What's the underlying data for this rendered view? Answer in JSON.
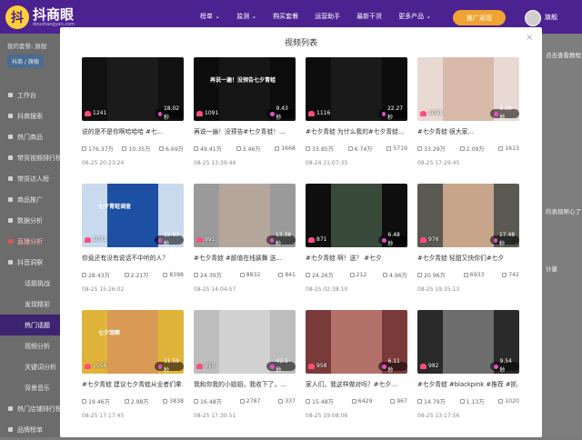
{
  "app": {
    "logo_text": "抖商眼",
    "logo_sub": "doushangyan.com",
    "logo_mark": "抖"
  },
  "nav": [
    "榜单 ⌄",
    "监测 ⌄",
    "购买套餐",
    "运营助手",
    "最新干货",
    "更多产品 ⌄"
  ],
  "header": {
    "promo_label": "推广返现",
    "user_name": "旗舰"
  },
  "sidebar": {
    "plan": "我的套餐: 旗舰",
    "pill": "抖商 / 旗舰",
    "items": [
      {
        "label": "工作台",
        "level": "top"
      },
      {
        "label": "抖商搜索",
        "level": "top"
      },
      {
        "label": "热门商品",
        "level": "top"
      },
      {
        "label": "带货视频排行榜",
        "level": "top"
      },
      {
        "label": "带货达人榜",
        "level": "top"
      },
      {
        "label": "商品推广",
        "level": "top"
      },
      {
        "label": "数据分析",
        "level": "top"
      },
      {
        "label": "直播分析",
        "level": "top",
        "state": "red"
      },
      {
        "label": "抖音洞察",
        "level": "top"
      },
      {
        "label": "话题挑战",
        "level": "sub"
      },
      {
        "label": "发现精彩",
        "level": "sub"
      },
      {
        "label": "热门话题",
        "level": "sub",
        "state": "active"
      },
      {
        "label": "视频分析",
        "level": "sub"
      },
      {
        "label": "关键词分析",
        "level": "sub"
      },
      {
        "label": "背景音乐",
        "level": "sub"
      },
      {
        "label": "热门店铺排行榜",
        "level": "top"
      },
      {
        "label": "品牌榜单",
        "level": "top"
      }
    ]
  },
  "background": {
    "right_top": "点击查看教程",
    "right_mid": "的表现帮心了",
    "right_lower": "计量"
  },
  "modal": {
    "title": "视频列表",
    "close": "×"
  },
  "videos": [
    {
      "likes": "1241",
      "duration": "18.02秒",
      "title": "说的是不是你啊哈哈哈 #七...",
      "plays": "176.37万",
      "comments": "10.35万",
      "shares": "6.69万",
      "date": "08-25 20:23:24",
      "bg": "#111111",
      "inner": "#1b1b1b"
    },
    {
      "likes": "1091",
      "duration": "9.43秒",
      "title": "再说一遍！没预告#七夕青蛙！...",
      "plays": "49.41万",
      "comments": "3.46万",
      "shares": "1668",
      "date": "08-25 13:39:44",
      "bg": "#0c0c0c",
      "inner": "#161616",
      "caption": "再说一遍！没预告七夕青蛙"
    },
    {
      "likes": "1116",
      "duration": "22.27秒",
      "title": "#七夕青蛙 为什么我的#七夕青蛙...",
      "plays": "33.85万",
      "comments": "6.74万",
      "shares": "5719",
      "date": "08-24 21:07:35",
      "bg": "#0d0d0d",
      "inner": "#1a1a1a"
    },
    {
      "likes": "1051",
      "duration": "5.39秒",
      "title": "#七夕青蛙 很大家...",
      "plays": "33.29万",
      "comments": "2.09万",
      "shares": "1613",
      "date": "08-25 17:29:45",
      "bg": "#e8d9d3",
      "inner": "#d8b9aa"
    },
    {
      "likes": "1071",
      "duration": "12.83秒",
      "title": "你竟还有没有说话不中听的人？",
      "plays": "28.43万",
      "comments": "2.21万",
      "shares": "8398",
      "date": "08-25 15:26:02",
      "bg": "#c9d9ee",
      "inner": "#1d4fa3",
      "caption": "七夕青蛙调查"
    },
    {
      "likes": "991",
      "duration": "13.38秒",
      "title": "#七夕青蛙 #颜值在线装舞 送...",
      "plays": "24.39万",
      "comments": "8832",
      "shares": "841",
      "date": "08-25 14:04:57",
      "bg": "#9a9a9a",
      "inner": "#b5a69c"
    },
    {
      "likes": "871",
      "duration": "6.48秒",
      "title": "#七夕青蛙 啊！送？ #七夕",
      "plays": "24.26万",
      "comments": "212",
      "shares": "4.96万",
      "date": "08-25 02:38:10",
      "bg": "#0f0f0f",
      "inner": "#3a4a3a"
    },
    {
      "likes": "976",
      "duration": "17.48秒",
      "title": "#七夕青蛙 轻甜又快你们#七夕",
      "plays": "20.96万",
      "comments": "6933",
      "shares": "742",
      "date": "08-25 19:35:13",
      "bg": "#5a5a52",
      "inner": "#c7a58a"
    },
    {
      "likes": "1056",
      "duration": "11.59秒",
      "title": "#七夕青蛙 建议七夕青蛙从业者们拿...",
      "plays": "19.46万",
      "comments": "2.98万",
      "shares": "3838",
      "date": "08-25 17:17:45",
      "bg": "#e0b43a",
      "inner": "#d89a55",
      "caption": "七夕观察"
    },
    {
      "likes": "910",
      "duration": "42.5秒",
      "title": "我和你我的小姐姐，我收下了，...",
      "plays": "16.48万",
      "comments": "2787",
      "shares": "337",
      "date": "08-25 17:30:51",
      "bg": "#bdbdbd",
      "inner": "#d2d2d2"
    },
    {
      "likes": "958",
      "duration": "6.11秒",
      "title": "家人们，我这样做对吗？#七夕...",
      "plays": "15.48万",
      "comments": "6429",
      "shares": "967",
      "date": "08-25 19:08:06",
      "bg": "#7a3a3a",
      "inner": "#b3716a"
    },
    {
      "likes": "982",
      "duration": "9.54秒",
      "title": "#七夕青蛙 #blackpink #推荐 #抓...",
      "plays": "14.79万",
      "comments": "1.13万",
      "shares": "1020",
      "date": "08-25 13:17:56",
      "bg": "#2a2a2a",
      "inner": "#6d6d6d"
    }
  ]
}
